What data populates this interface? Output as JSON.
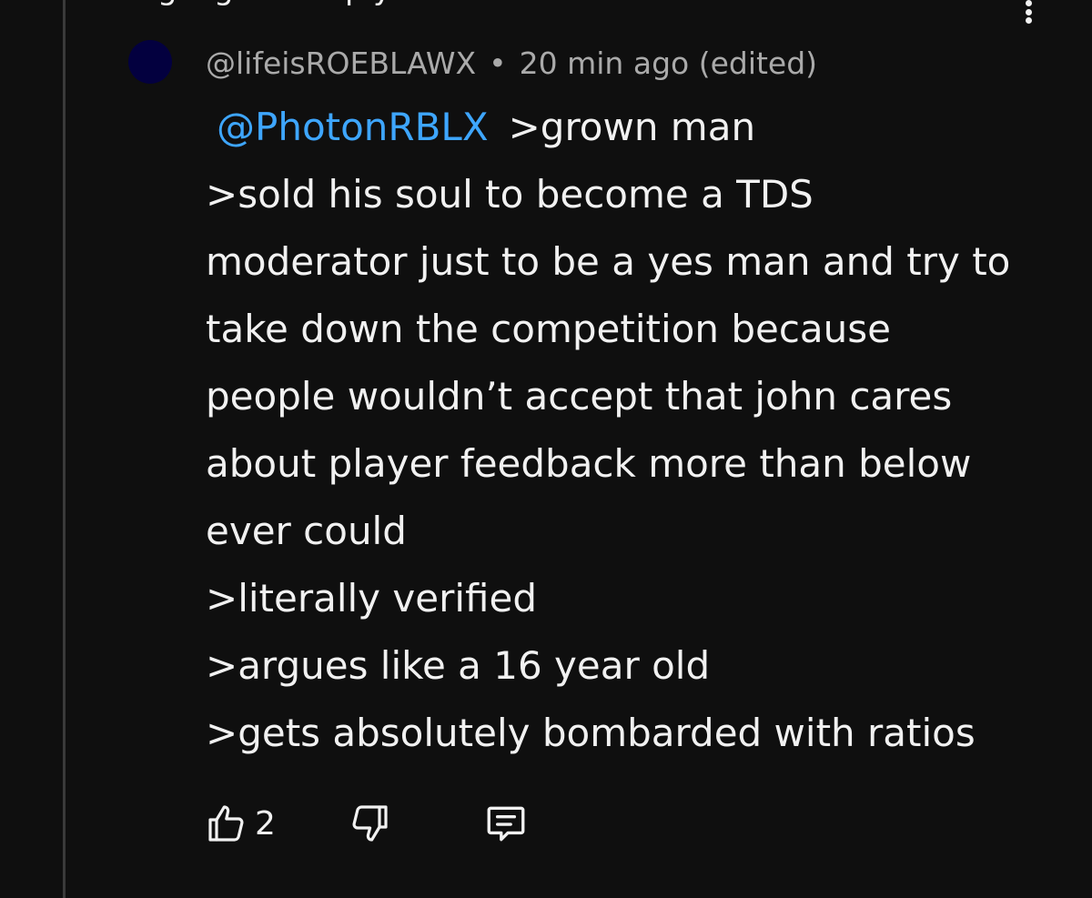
{
  "header": {
    "partial_title": "Highlighted reply"
  },
  "comment": {
    "author": "@lifeisROEBLAWX",
    "separator": "•",
    "time": "20 min ago (edited)",
    "mention": "@PhotonRBLX",
    "lines": [
      ">grown man",
      ">sold his soul to become a TDS",
      "moderator just to be a yes man and try to",
      "take down the competition because",
      "people wouldn’t accept that john cares",
      "about player feedback more than below",
      "ever could",
      ">literally verified",
      ">argues like a 16 year old",
      ">gets absolutely bombarded with ratios"
    ],
    "like_count": "2"
  },
  "colors": {
    "background": "#0f0f0f",
    "mention": "#3ea6ff",
    "meta_text": "#aaaaaa",
    "avatar": "#03003f"
  },
  "icons": [
    "more-vert-icon",
    "thumbs-up-icon",
    "thumbs-down-icon",
    "comment-reply-icon"
  ]
}
